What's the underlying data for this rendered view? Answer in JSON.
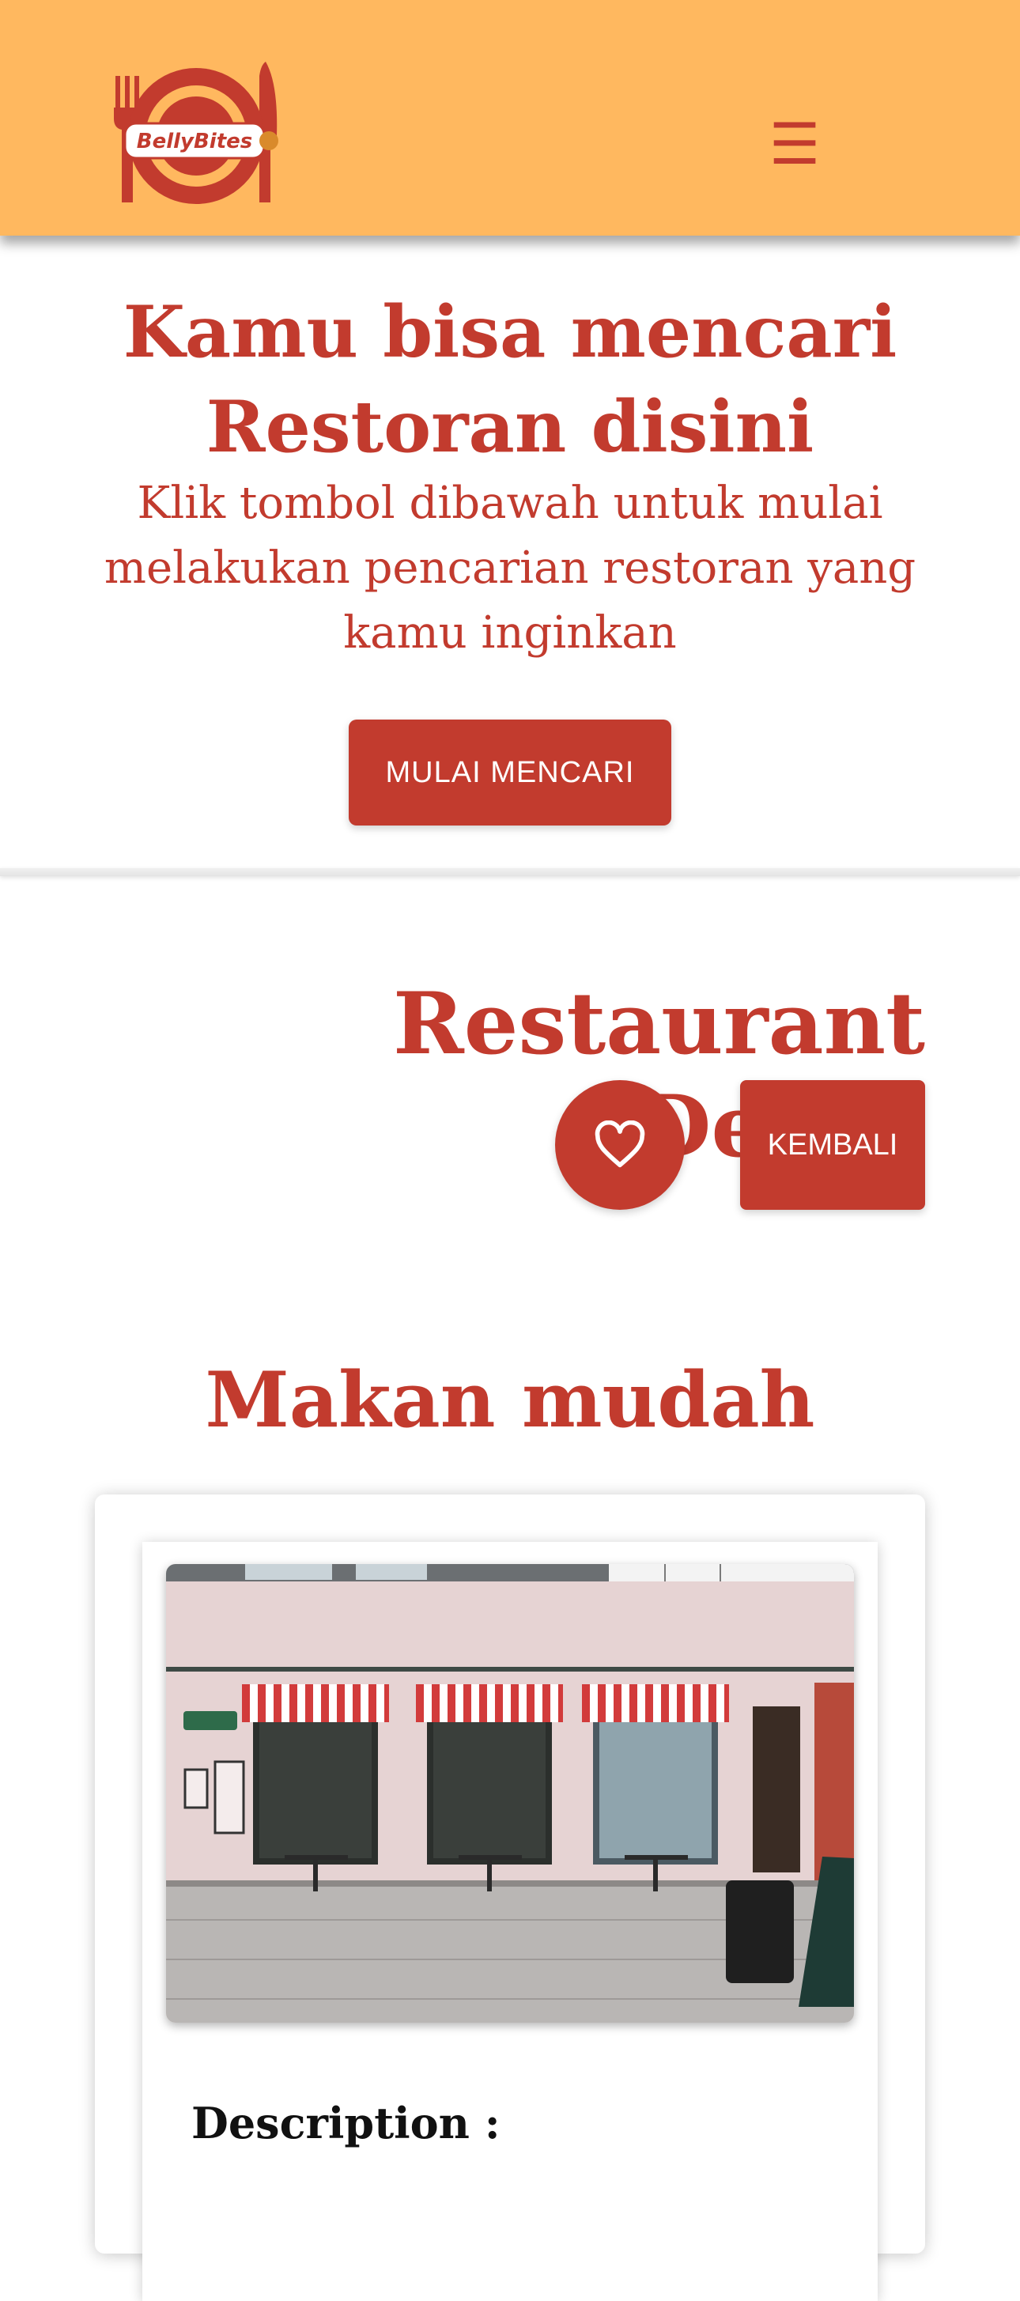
{
  "header": {
    "logo_text": "BellyBites",
    "menu_icon": "☰"
  },
  "hero": {
    "title": "Kamu bisa mencari Restoran disini",
    "subtitle": "Klik tombol dibawah untuk mulai melakukan pencarian restoran yang kamu inginkan",
    "cta_label": "MULAI MENCARI"
  },
  "detail": {
    "title": "Restaurant Detail",
    "back_label": "KEMBALI",
    "favorite_icon": "heart-outline-icon"
  },
  "restaurant": {
    "name": "Makan mudah",
    "description_label": "Description :"
  },
  "colors": {
    "header_bg": "#FFB85F",
    "accent": "#C23B2E"
  }
}
